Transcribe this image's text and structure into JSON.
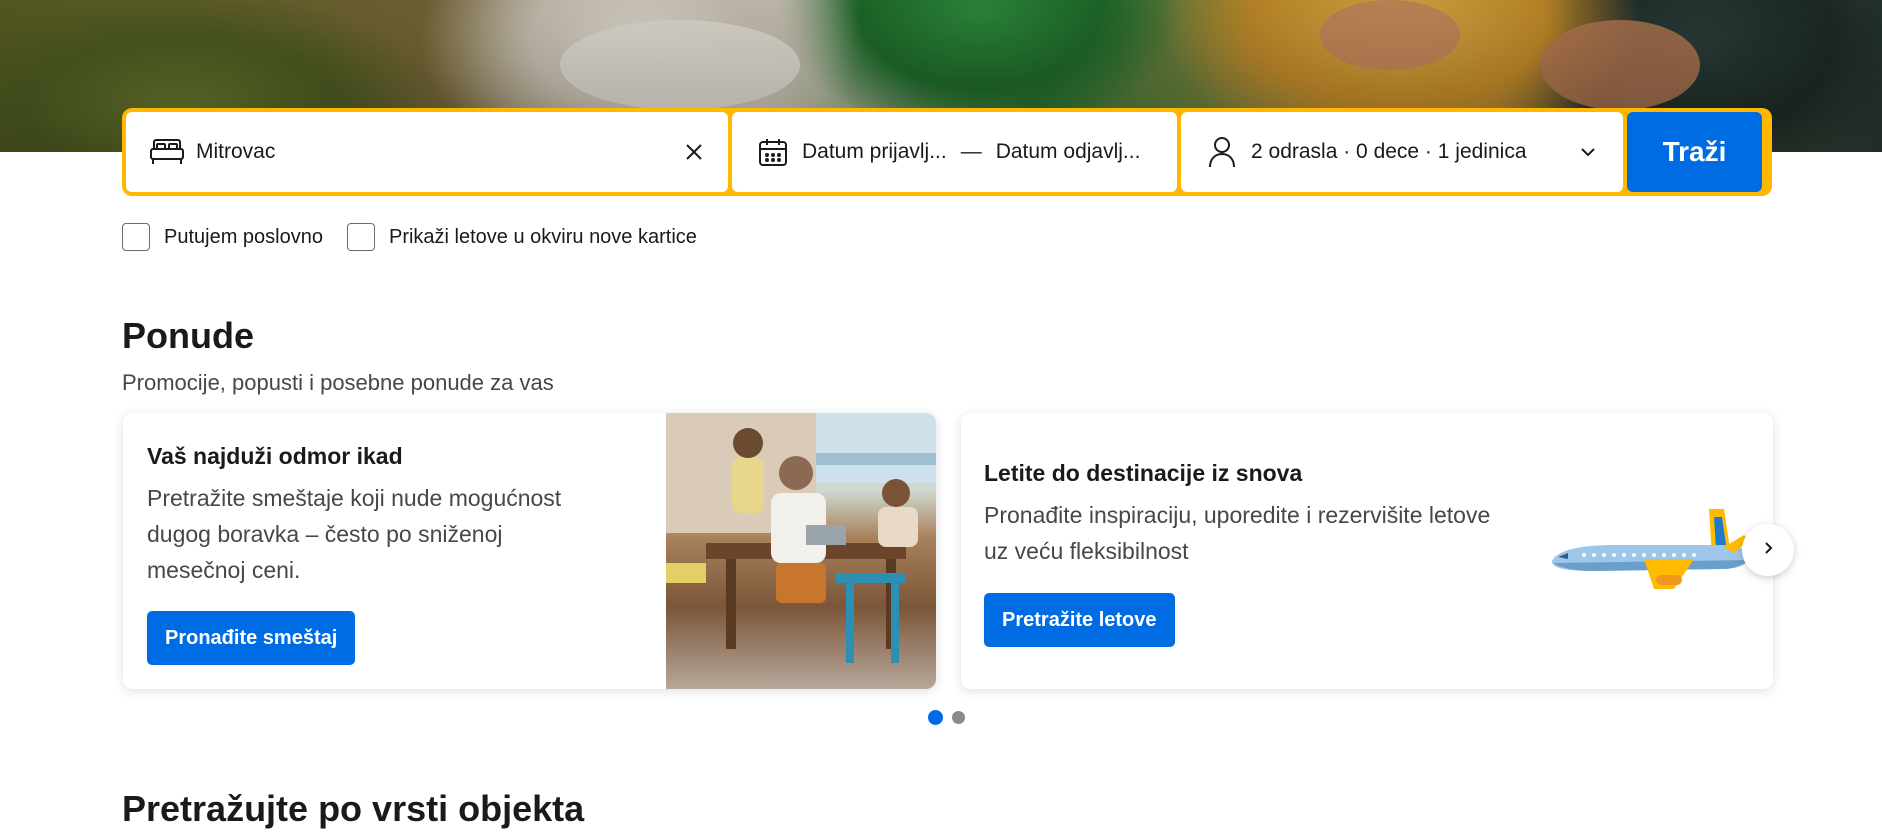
{
  "search": {
    "destination_value": "Mitrovac",
    "checkin_label": "Datum prijavlj...",
    "date_separator": "—",
    "checkout_label": "Datum odjavlj...",
    "guests_label": "2 odrasla · 0 dece · 1 jedinica",
    "search_button": "Traži"
  },
  "options": {
    "business_travel": "Putujem poslovno",
    "flights_new_tab": "Prikaži letove u okviru nove kartice"
  },
  "offers": {
    "title": "Ponude",
    "subtitle": "Promocije, popusti i posebne ponude za vas",
    "cards": [
      {
        "title": "Vaš najduži odmor ikad",
        "body_lines": [
          "Pretražite smeštaje koji nude mogućnost",
          "dugog boravka – često po sniženoj",
          "mesečnoj ceni."
        ],
        "button": "Pronađite smeštaj"
      },
      {
        "title": "Letite do destinacije iz snova",
        "body_lines": [
          "Pronađite inspiraciju, uporedite i rezervišite letove",
          "uz veću fleksibilnost"
        ],
        "button": "Pretražite letove"
      }
    ],
    "carousel_total_pages": 2,
    "carousel_active_page": 1
  },
  "property_types": {
    "title": "Pretražujte po vrsti objekta"
  },
  "colors": {
    "brand_blue": "#006ce4",
    "search_border": "#ffb700"
  }
}
